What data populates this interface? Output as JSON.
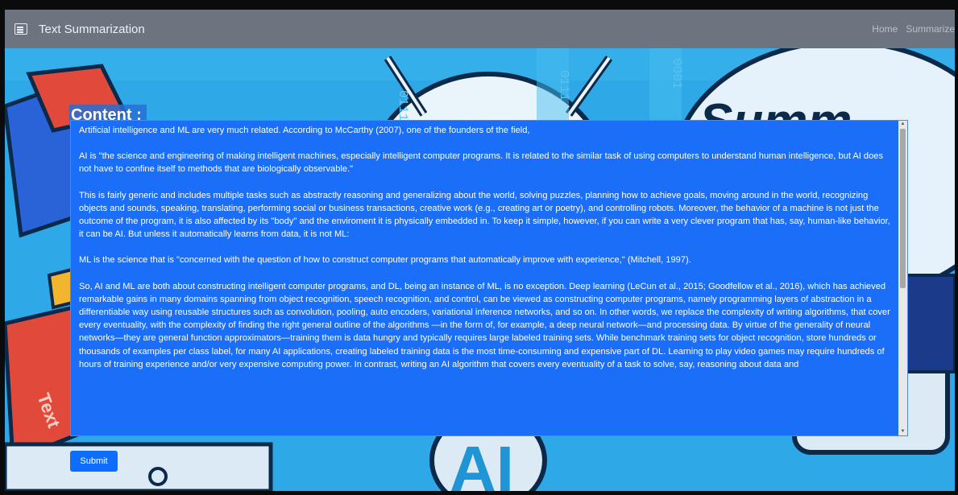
{
  "navbar": {
    "brand_icon": "document-icon",
    "title": "Text Summarization",
    "links": [
      "Home",
      "Summarize"
    ]
  },
  "background": {
    "word": "Summ",
    "big_letters": "AI",
    "side_text": "Text",
    "binary": [
      "0111",
      "0111",
      "0001"
    ]
  },
  "form": {
    "label": "Content :",
    "paragraphs": [
      "Artificial intelligence and ML are very much related. According to McCarthy (2007), one of the founders of the field,",
      "AI is \"the science and engineering of making intelligent machines, especially intelligent computer programs. It is related to the similar task of using computers to understand human intelligence, but AI does not have to confine itself to methods that are biologically observable.\"",
      "This is fairly generic and includes multiple tasks such as abstractly reasoning and generalizing about the world, solving puzzles, planning how to achieve goals, moving around in the world, recognizing objects and sounds, speaking, translating, performing social or business transactions, creative work (e.g., creating art or poetry), and controlling robots. Moreover, the behavior of a machine is not just the outcome of the program, it is also affected by its \"body\" and the enviroment it is physically embedded in. To keep it simple, however, if you can write a very clever program that has, say, human-like behavior, it can be AI. But unless it automatically learns from data, it is not ML:",
      "ML is the science that is \"concerned with the question of how to construct computer programs that automatically improve with experience,\" (Mitchell, 1997).",
      "So, AI and ML are both about constructing intelligent computer programs, and DL, being an instance of ML, is no exception. Deep learning (LeCun et al., 2015; Goodfellow et al., 2016), which has achieved remarkable gains in many domains spanning from object recognition, speech recognition, and control, can be viewed as constructing computer programs, namely programming layers of abstraction in a differentiable way using reusable structures such as convolution, pooling, auto encoders, variational inference networks, and so on. In other words, we replace the complexity of writing algorithms, that cover every eventuality, with the complexity of finding the right general outline of the algorithms —in the form of, for example, a deep neural network—and processing data. By virtue of the generality of neural networks—they are general function approximators—training them is data hungry and typically requires large labeled training sets. While benchmark training sets for object recognition, store hundreds or thousands of examples per class label, for many AI applications, creating labeled training data is the most time-consuming and expensive part of DL. Learning to play video games may require hundreds of hours of training experience and/or very expensive computing power. In contrast, writing an AI algorithm that covers every eventuality of a task to solve, say, reasoning about data and"
    ],
    "submit_label": "Submit"
  },
  "colors": {
    "navbar": "#6c7480",
    "textarea": "#1a6ef7",
    "button": "#0d6efd",
    "background": "#2ea8e6"
  }
}
